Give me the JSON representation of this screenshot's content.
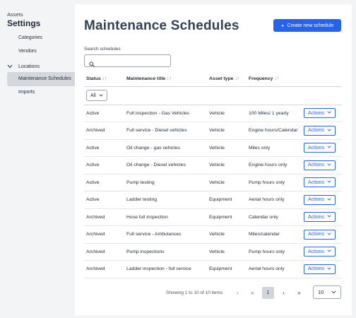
{
  "sidebar": {
    "section_label": "Assets",
    "title": "Settings",
    "items": [
      {
        "label": "Categories"
      },
      {
        "label": "Vendors"
      }
    ],
    "group": {
      "label": "Locations"
    },
    "active_item": {
      "label": "Maintenance Schedules"
    },
    "bottom_item": {
      "label": "Imports"
    }
  },
  "header": {
    "title": "Maintenance Schedules",
    "create_button_label": "Create new schedule",
    "create_button_icon": "plus-icon"
  },
  "search": {
    "label": "Search schedules",
    "value": "",
    "placeholder": ""
  },
  "table": {
    "columns": [
      {
        "label": "Status",
        "sort": "↓↑"
      },
      {
        "label": "Maintenance title",
        "sort": "↓↑"
      },
      {
        "label": "Asset type",
        "sort": "↓↑"
      },
      {
        "label": "Frequency",
        "sort": "↓↑"
      }
    ],
    "status_filter": "All",
    "rows": [
      {
        "status": "Active",
        "title": "Full inspection - Gas Vehicles",
        "asset_type": "Vehicle",
        "frequency": "100 Miles/ 1 yearly",
        "action": "Actions"
      },
      {
        "status": "Archived",
        "title": "Full service - Diesel vehicles",
        "asset_type": "Vehicle",
        "frequency": "Engine hours/Calendar",
        "action": "Actions"
      },
      {
        "status": "Active",
        "title": "Oil change - gas vehicles",
        "asset_type": "Vehicle",
        "frequency": "Miles only",
        "action": "Actions"
      },
      {
        "status": "Active",
        "title": "Oil change - Diesel vehicles",
        "asset_type": "Vehicle",
        "frequency": "Engine hours only",
        "action": "Actions"
      },
      {
        "status": "Active",
        "title": "Pump testing",
        "asset_type": "Vehicle",
        "frequency": "Pump hours only",
        "action": "Actions"
      },
      {
        "status": "Active",
        "title": "Ladder testing",
        "asset_type": "Equipment",
        "frequency": "Aerial hours only",
        "action": "Actions"
      },
      {
        "status": "Archived",
        "title": "Hose full inspection",
        "asset_type": "Equipment",
        "frequency": "Calendar only",
        "action": "Actions"
      },
      {
        "status": "Archived",
        "title": "Full service - Ambulances",
        "asset_type": "Vehicle",
        "frequency": "Miles/calendar",
        "action": "Actions"
      },
      {
        "status": "Archived",
        "title": "Pump inspections",
        "asset_type": "Vehicle",
        "frequency": "Pump hours only",
        "action": "Actions"
      },
      {
        "status": "Archived",
        "title": "Ladder inspection - full service",
        "asset_type": "Equipment",
        "frequency": "Aerial hours only",
        "action": "Actions"
      }
    ]
  },
  "pagination": {
    "info": "Showing 1 to 10 of 10 items",
    "prev": "‹",
    "first": "«",
    "current_page": "1",
    "next": "›",
    "last": "»",
    "page_size": "10"
  },
  "colors": {
    "accent": "#2563eb",
    "sidebar_bg": "#f3f4f6",
    "active_item_bg": "#d4d7dc",
    "title": "#334155"
  }
}
